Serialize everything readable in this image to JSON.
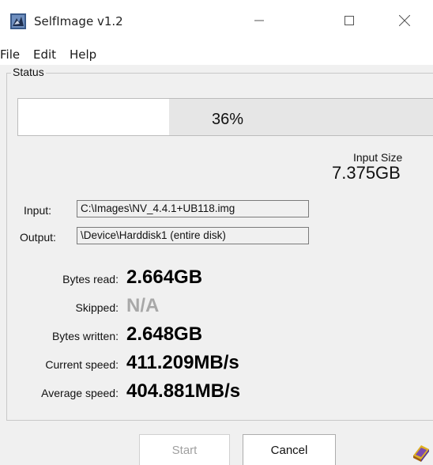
{
  "window": {
    "title": "SelfImage v1.2",
    "icon": "selfimage-app-icon",
    "controls": [
      "minimize-icon",
      "maximize-icon",
      "close-icon"
    ]
  },
  "menu": {
    "file": "File",
    "edit": "Edit",
    "help": "Help"
  },
  "status": {
    "group_label": "Status",
    "progress_percent": 36,
    "progress_text": "36%",
    "input_size_label": "Input Size",
    "input_size_value": "7.375GB"
  },
  "fields": {
    "input_label": "Input:",
    "input_value": "C:\\Images\\NV_4.4.1+UB118.img",
    "output_label": "Output:",
    "output_value": "\\Device\\Harddisk1 (entire disk)"
  },
  "stats": {
    "bytes_read_label": "Bytes read:",
    "bytes_read_value": "2.664GB",
    "skipped_label": "Skipped:",
    "skipped_value": "N/A",
    "bytes_written_label": "Bytes written:",
    "bytes_written_value": "2.648GB",
    "current_speed_label": "Current speed:",
    "current_speed_value": "411.209MB/s",
    "average_speed_label": "Average speed:",
    "average_speed_value": "404.881MB/s"
  },
  "buttons": {
    "start": "Start",
    "start_enabled": false,
    "cancel": "Cancel"
  },
  "colors": {
    "window_bg": "#f0f0f0",
    "disabled_text": "#a8a8a8"
  }
}
